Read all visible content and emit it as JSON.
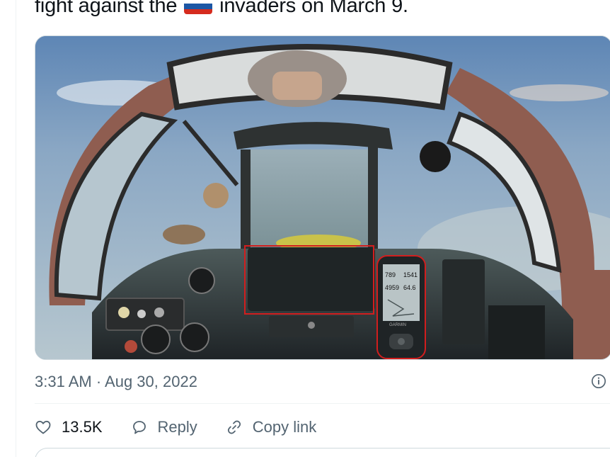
{
  "tweet": {
    "text_before_flag": "fight against the",
    "text_after_flag": "invaders on March 9.",
    "flag_colors": [
      "#ffffff",
      "#1c57a5",
      "#d52b1e"
    ],
    "flag_icon": "russia-flag-icon"
  },
  "media": {
    "gps_readout": {
      "row1_left": "789",
      "row1_right": "1541",
      "row2_left": "4959",
      "row2_right": "64.6",
      "brand": "GARMIN"
    }
  },
  "meta": {
    "timestamp": "3:31 AM · Aug 30, 2022",
    "info_icon": "info-icon"
  },
  "actions": {
    "like_count": "13.5K",
    "reply_label": "Reply",
    "copy_link_label": "Copy link",
    "like_icon": "heart-icon",
    "reply_icon": "speech-bubble-icon",
    "link_icon": "link-icon"
  },
  "colors": {
    "text": "#0f1419",
    "muted": "#536471",
    "divider": "#eff3f4"
  }
}
